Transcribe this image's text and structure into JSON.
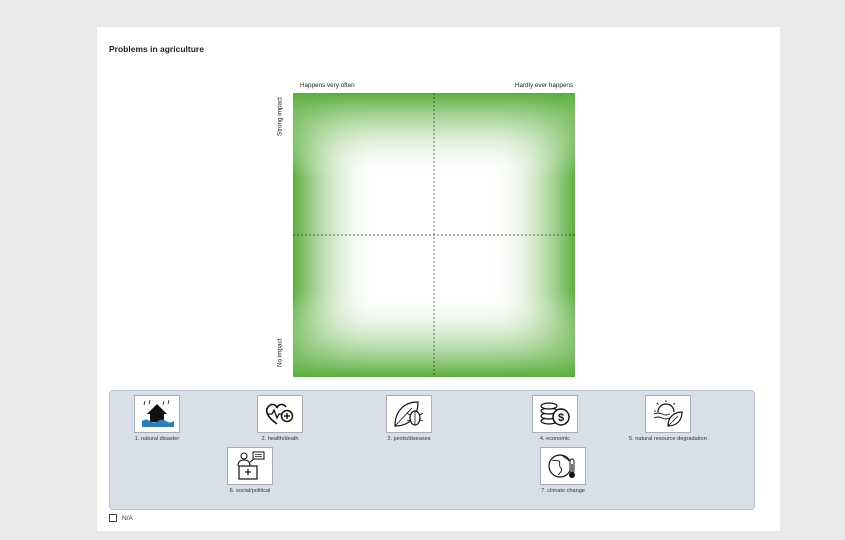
{
  "question": {
    "title": "Problems in agriculture"
  },
  "matrix": {
    "top_left_label": "Happens very often",
    "top_right_label": "Hardly ever happens",
    "left_top_label": "Strong impact",
    "left_bottom_label": "No impact",
    "gradient_colors": {
      "edge": "#5aae3c",
      "center": "#ffffff"
    }
  },
  "items": [
    {
      "label": "1. natural disaster",
      "icon": "flood-house-icon"
    },
    {
      "label": "2. health/death",
      "icon": "heartbeat-plus-icon"
    },
    {
      "label": "3. pests/diseases",
      "icon": "leaf-beetle-icon"
    },
    {
      "label": "4. economic",
      "icon": "coins-dollar-icon"
    },
    {
      "label": "5. natural resource degradation",
      "icon": "sun-leaf-icon"
    },
    {
      "label": "6. social/political",
      "icon": "speaker-podium-icon"
    },
    {
      "label": "7. climate change",
      "icon": "globe-thermometer-icon"
    }
  ],
  "na_option": {
    "label": "N/A",
    "checked": false
  }
}
